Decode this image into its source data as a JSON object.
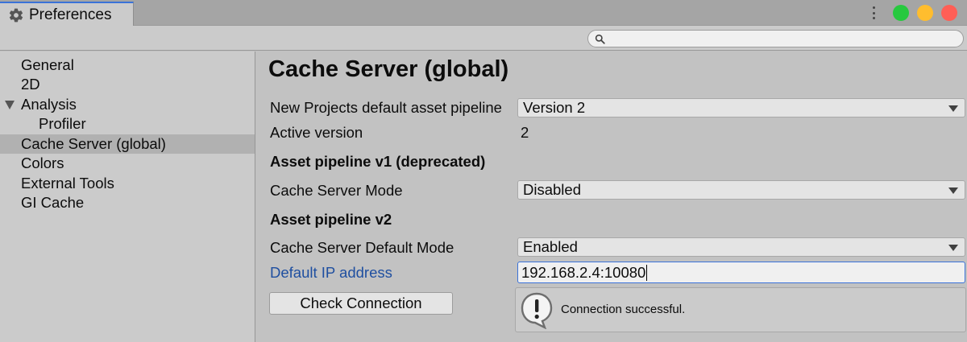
{
  "window": {
    "tab_title": "Preferences",
    "tab_icon": "gear-icon",
    "controls": {
      "green": "#27c93f",
      "yellow": "#ffbd2e",
      "red": "#ff5f56"
    }
  },
  "search": {
    "placeholder": "",
    "value": ""
  },
  "sidebar": {
    "items": [
      {
        "label": "General",
        "selected": false
      },
      {
        "label": "2D",
        "selected": false
      },
      {
        "label": "Analysis",
        "expanded": true
      },
      {
        "label": "Profiler",
        "child": true
      },
      {
        "label": "Cache Server (global)",
        "selected": true
      },
      {
        "label": "Colors",
        "selected": false
      },
      {
        "label": "External Tools",
        "selected": false
      },
      {
        "label": "GI Cache",
        "selected": false
      }
    ]
  },
  "main": {
    "title": "Cache Server (global)",
    "default_pipeline": {
      "label": "New Projects default asset pipeline",
      "value": "Version 2"
    },
    "active_version": {
      "label": "Active version",
      "value": "2"
    },
    "v1_section": "Asset pipeline v1 (deprecated)",
    "v1_mode": {
      "label": "Cache Server Mode",
      "value": "Disabled"
    },
    "v2_section": "Asset pipeline v2",
    "v2_default_mode": {
      "label": "Cache Server Default Mode",
      "value": "Enabled"
    },
    "ip_address": {
      "label": "Default IP address",
      "value": "192.168.2.4:10080"
    },
    "check_button": "Check Connection",
    "help_message": "Connection successful.",
    "help_icon": "warning-icon"
  },
  "colors": {
    "accent": "#3a72d8",
    "link": "#1f4fa0",
    "panel": "#c2c2c2",
    "sidebar": "#cbcbcb",
    "selected": "#b1b1b1"
  }
}
